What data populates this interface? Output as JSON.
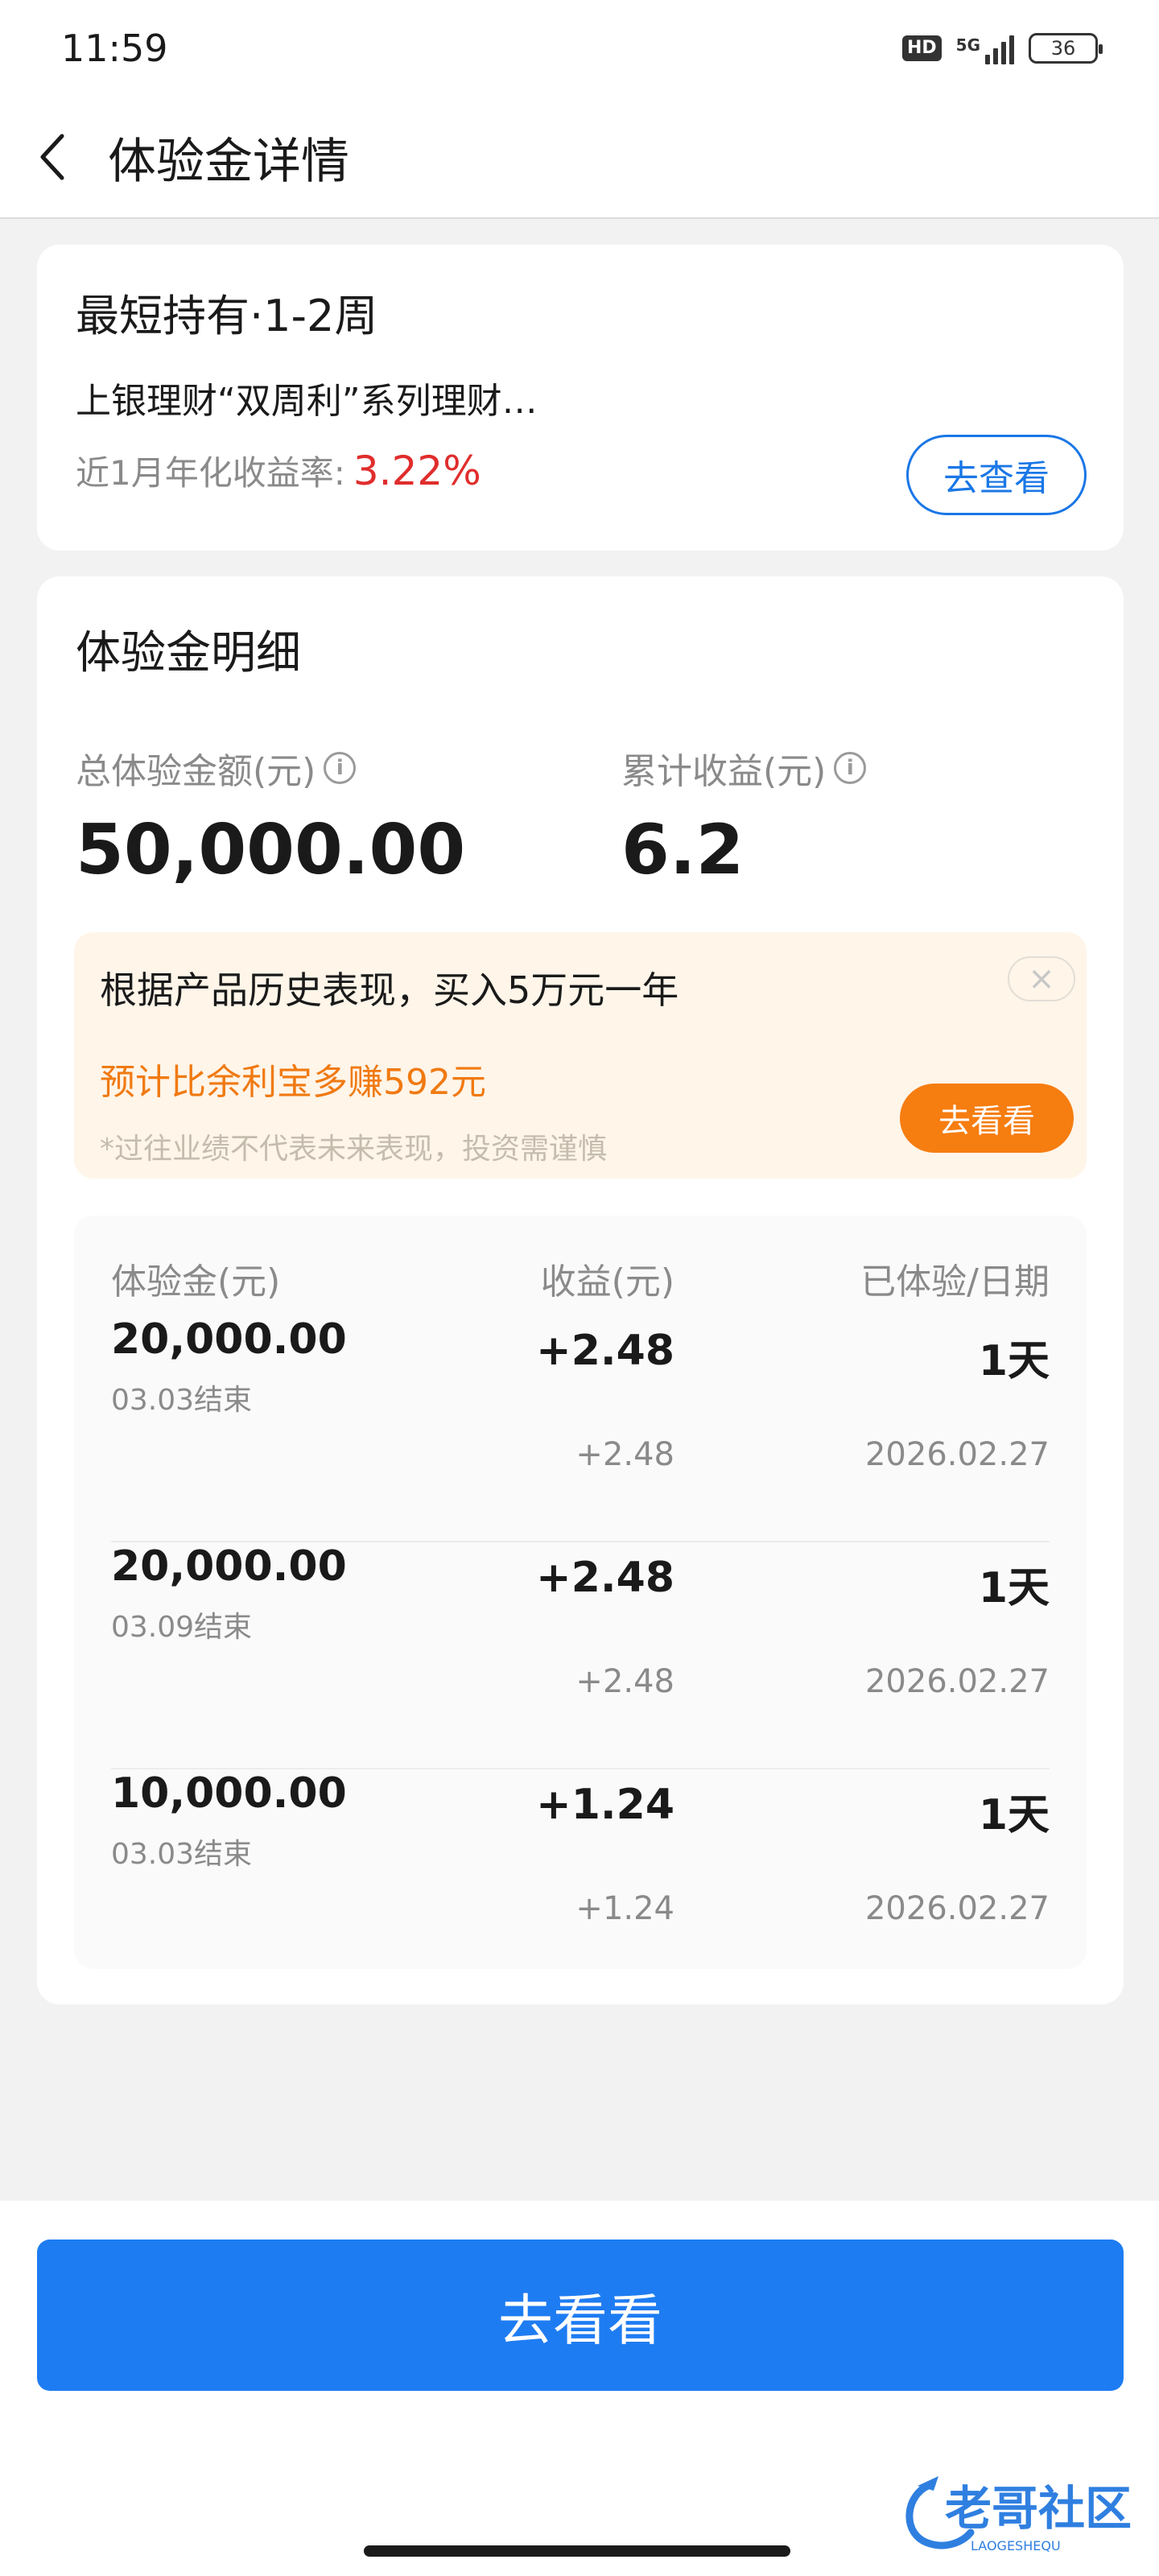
{
  "status_bar": {
    "time": "11:59",
    "hd": "HD",
    "network": "5G",
    "battery": "36"
  },
  "nav": {
    "title": "体验金详情"
  },
  "product_card": {
    "title": "最短持有·1-2周",
    "product_name": "上银理财“双周利”系列理财…",
    "rate_label": "近1月年化收益率:",
    "rate_value": "3.22%",
    "view_button": "去查看"
  },
  "detail_card": {
    "title": "体验金明细",
    "total_label": "总体验金额(元)",
    "total_value": "50,000.00",
    "income_label": "累计收益(元)",
    "income_value": "6.2",
    "promo": {
      "text": "根据产品历史表现，买入5万元一年",
      "highlight": "预计比余利宝多赚592元",
      "note": "*过往业绩不代表未来表现，投资需谨慎",
      "button": "去看看",
      "close": "×"
    },
    "table": {
      "headers": [
        "体验金(元)",
        "收益(元)",
        "已体验/日期"
      ],
      "rows": [
        {
          "amount": "20,000.00",
          "end": "03.03结束",
          "income": "+2.48",
          "income_sub": "+2.48",
          "days": "1天",
          "date": "2026.02.27"
        },
        {
          "amount": "20,000.00",
          "end": "03.09结束",
          "income": "+2.48",
          "income_sub": "+2.48",
          "days": "1天",
          "date": "2026.02.27"
        },
        {
          "amount": "10,000.00",
          "end": "03.03结束",
          "income": "+1.24",
          "income_sub": "+1.24",
          "days": "1天",
          "date": "2026.02.27"
        }
      ]
    }
  },
  "bottom": {
    "main_button": "去看看"
  },
  "watermark": {
    "text": "老哥社区",
    "sub": "LAOGESHEQU"
  },
  "colors": {
    "accent_blue": "#1e7cf2",
    "rate_red": "#e02d2d",
    "promo_orange": "#f67d10"
  }
}
